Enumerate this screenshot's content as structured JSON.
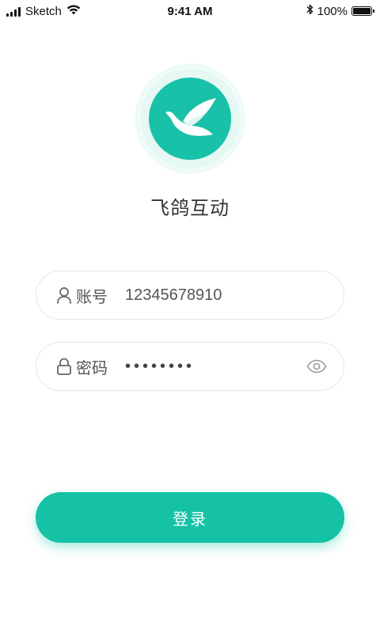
{
  "status_bar": {
    "carrier": "Sketch",
    "time": "9:41 AM",
    "battery": "100%",
    "battery_level": 1.0,
    "icons": [
      "signal-icon",
      "wifi-icon",
      "bluetooth-icon",
      "battery-icon"
    ]
  },
  "logo": {
    "icon": "bird-logo-icon",
    "color": "#18c1a7"
  },
  "app_name": "飞鸽互动",
  "form": {
    "account": {
      "icon": "user-icon",
      "label": "账号",
      "value": "12345678910"
    },
    "password": {
      "icon": "lock-icon",
      "label": "密码",
      "value_masked": "••••••••",
      "toggle_icon": "eye-icon"
    }
  },
  "login_button": {
    "label": "登录",
    "color": "#15c2a6"
  }
}
